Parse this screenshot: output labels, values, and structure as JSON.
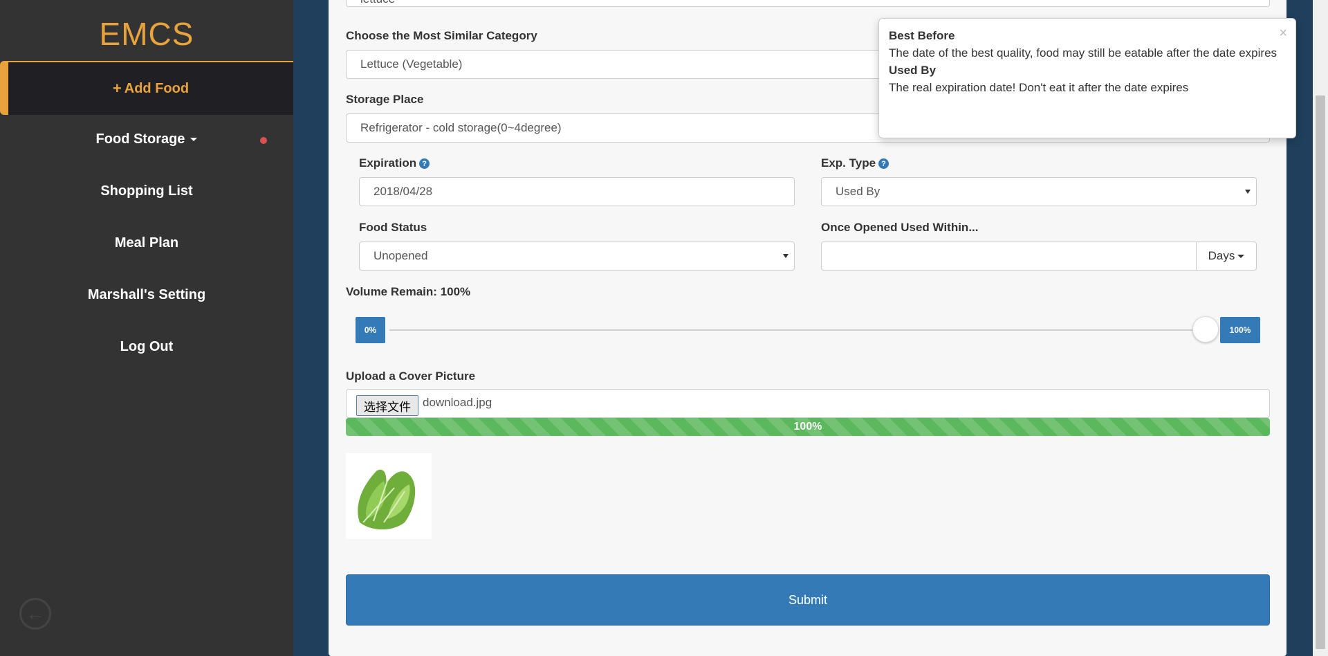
{
  "sidebar": {
    "brand": "EMCS",
    "active_item": "Add Food",
    "items": [
      {
        "label": "Food Storage"
      },
      {
        "label": "Shopping List"
      },
      {
        "label": "Meal Plan"
      },
      {
        "label": "Marshall's Setting"
      },
      {
        "label": "Log Out"
      }
    ]
  },
  "form": {
    "top_input_value": "lettuce",
    "category": {
      "label": "Choose the Most Similar Category",
      "value": "Lettuce (Vegetable)"
    },
    "storage": {
      "label": "Storage Place",
      "value": "Refrigerator - cold storage(0~4degree)"
    },
    "expiration": {
      "label": "Expiration",
      "value": "2018/04/28"
    },
    "exp_type": {
      "label": "Exp. Type",
      "value": "Used By"
    },
    "food_status": {
      "label": "Food Status",
      "value": "Unopened"
    },
    "once_opened": {
      "label": "Once Opened Used Within...",
      "value": "",
      "unit": "Days"
    },
    "volume": {
      "label": "Volume Remain: 100%",
      "min_label": "0%",
      "max_label": "100%",
      "value_percent": 100
    },
    "upload": {
      "label": "Upload a Cover Picture",
      "button": "选择文件",
      "file_name": "download.jpg",
      "progress_label": "100%",
      "progress_percent": 100
    },
    "submit_label": "Submit"
  },
  "popover": {
    "title1": "Best Before",
    "text1": "The date of the best quality, food may still be eatable after the date expires",
    "title2": "Used By",
    "text2": "The real expiration date! Don't eat it after the date expires",
    "close": "×"
  },
  "icons": {
    "help": "?",
    "plus": "+",
    "back": "←"
  },
  "colors": {
    "accent": "#e8a33d",
    "primary": "#337ab7",
    "success": "#5cb85c",
    "sidebar": "#333333",
    "background": "#1f3f5c"
  }
}
